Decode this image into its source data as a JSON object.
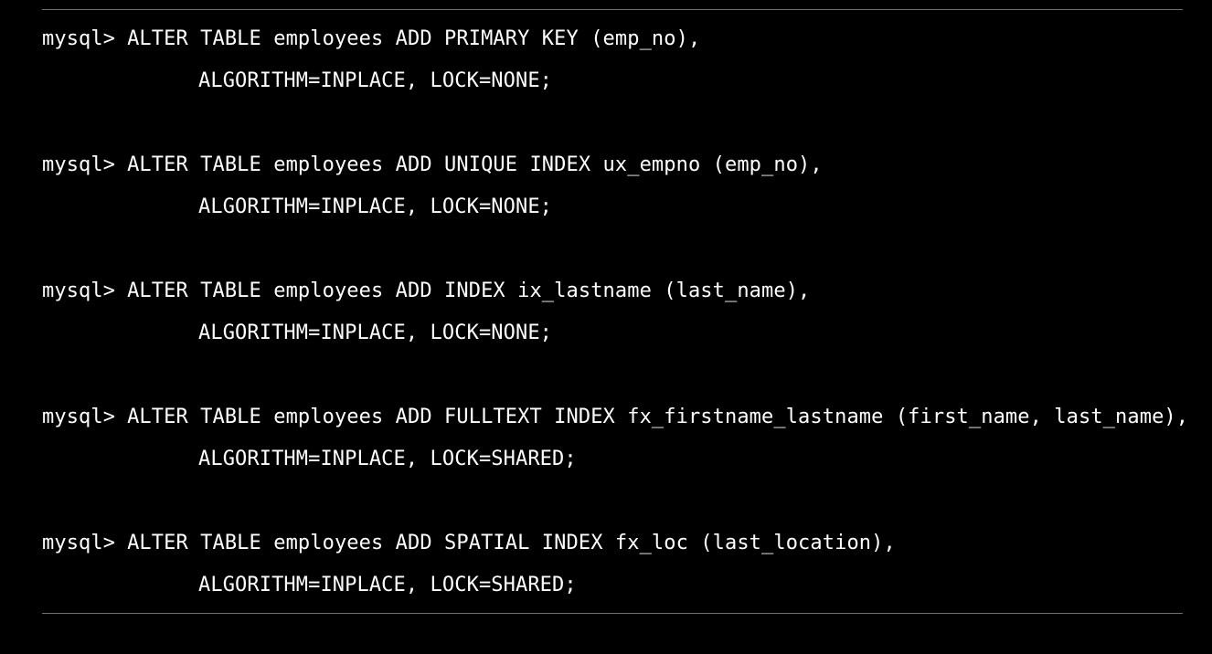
{
  "terminal": {
    "prompt": "mysql>",
    "statements": [
      {
        "line1": "ALTER TABLE employees ADD PRIMARY KEY (emp_no),",
        "line2": "ALGORITHM=INPLACE, LOCK=NONE;"
      },
      {
        "line1": "ALTER TABLE employees ADD UNIQUE INDEX ux_empno (emp_no),",
        "line2": "ALGORITHM=INPLACE, LOCK=NONE;"
      },
      {
        "line1": "ALTER TABLE employees ADD INDEX ix_lastname (last_name),",
        "line2": "ALGORITHM=INPLACE, LOCK=NONE;"
      },
      {
        "line1": "ALTER TABLE employees ADD FULLTEXT INDEX fx_firstname_lastname (first_name, last_name),",
        "line2": "ALGORITHM=INPLACE, LOCK=SHARED;"
      },
      {
        "line1": "ALTER TABLE employees ADD SPATIAL INDEX fx_loc (last_location),",
        "line2": "ALGORITHM=INPLACE, LOCK=SHARED;"
      }
    ]
  },
  "colors": {
    "background": "#000000",
    "text": "#ffffff",
    "rule": "#6f6f6f"
  }
}
